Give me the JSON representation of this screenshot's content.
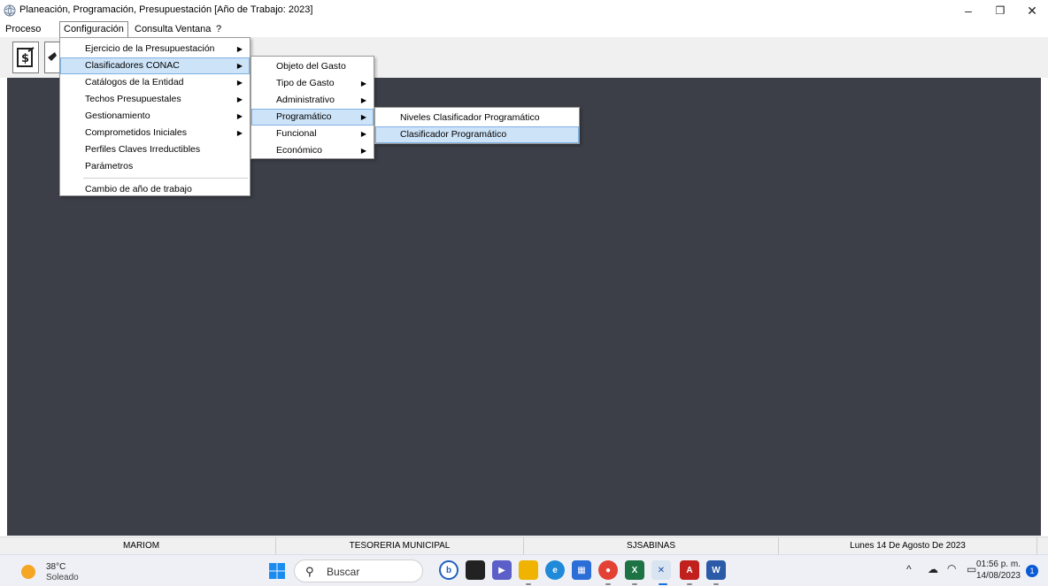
{
  "window": {
    "title": "Planeación, Programación, Presupuestación [Año de Trabajo: 2023]",
    "minimize_glyph": "–",
    "restore_glyph": "❐",
    "close_glyph": "✕"
  },
  "menubar": {
    "items": [
      "Proceso",
      "Configuración",
      "Consulta",
      "Ventana",
      "?"
    ]
  },
  "menu_configuracion": {
    "items": [
      "Ejercicio de la Presupuestación",
      "Clasificadores CONAC",
      "Catálogos de la Entidad",
      "Techos Presupuestales",
      "Gestionamiento",
      "Comprometidos Iniciales",
      "Perfiles Claves Irreductibles",
      "Parámetros",
      "Cambio de año de trabajo"
    ]
  },
  "menu_clasificadores": {
    "items": [
      "Objeto del Gasto",
      "Tipo de Gasto",
      "Administrativo",
      "Programático",
      "Funcional",
      "Económico"
    ]
  },
  "menu_programatico": {
    "items": [
      "Niveles Clasificador Programático",
      "Clasificador Programático"
    ]
  },
  "statusbar": {
    "user": "MARIOM",
    "department": "TESORERIA MUNICIPAL",
    "database": "SJSABINAS",
    "date": "Lunes 14 De Agosto De 2023"
  },
  "taskbar": {
    "weather_temp": "38°C",
    "weather_desc": "Soleado",
    "search_placeholder": "Buscar",
    "clock_time": "01:56 p. m.",
    "clock_date": "14/08/2023",
    "notification_count": "1"
  },
  "colors": {
    "mdi_background": "#3c3f47",
    "menu_highlight": "#cde3f7",
    "menu_highlight_border": "#7fb1e3"
  }
}
